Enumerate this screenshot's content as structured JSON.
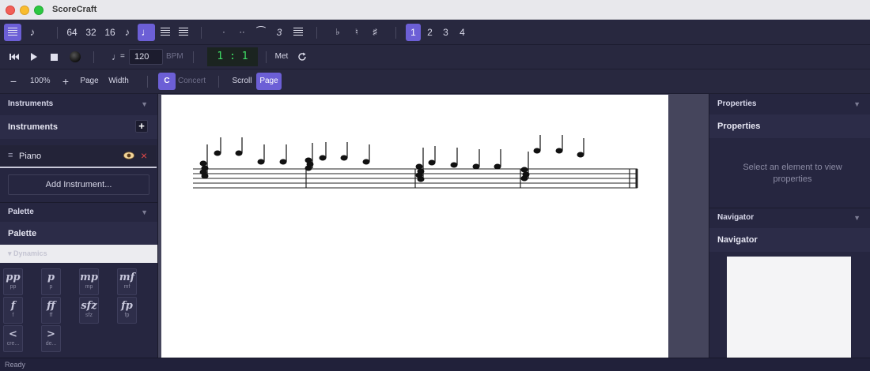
{
  "app": {
    "title": "ScoreCraft"
  },
  "toolbar1": {
    "durations": [
      "64",
      "32",
      "16",
      "♪",
      "♩"
    ],
    "dots": [
      "·",
      "··"
    ],
    "tie": "⁀",
    "tuplet": "3",
    "accidentals": [
      "♭",
      "♮",
      "♯"
    ],
    "voices": [
      "1",
      "2",
      "3",
      "4"
    ]
  },
  "toolbar2": {
    "tempo_note": "♩",
    "tempo_equals": "=",
    "bpm_value": "120",
    "bpm_label": "BPM",
    "position": "1 : 1",
    "metronome_label": "Met"
  },
  "toolbar3": {
    "zoom": "100%",
    "page_fit": "Page",
    "width_fit": "Width",
    "concert_badge": "C",
    "concert_label": "Concert",
    "scroll_label": "Scroll",
    "page_label": "Page"
  },
  "instruments_panel": {
    "header": "Instruments",
    "title": "Instruments",
    "items": [
      {
        "name": "Piano"
      }
    ],
    "add_button": "Add Instrument..."
  },
  "palette_panel": {
    "header": "Palette",
    "title": "Palette",
    "section": "Dynamics",
    "dynamics": [
      {
        "symbol": "pp",
        "label": "pp"
      },
      {
        "symbol": "p",
        "label": "p"
      },
      {
        "symbol": "mp",
        "label": "mp"
      },
      {
        "symbol": "mf",
        "label": "mf"
      },
      {
        "symbol": "f",
        "label": "f"
      },
      {
        "symbol": "ff",
        "label": "ff"
      },
      {
        "symbol": "sfz",
        "label": "sfz"
      },
      {
        "symbol": "fp",
        "label": "fp"
      },
      {
        "symbol": "<",
        "label": "cre..."
      },
      {
        "symbol": ">",
        "label": "de..."
      }
    ]
  },
  "properties_panel": {
    "header": "Properties",
    "title": "Properties",
    "empty_message": "Select an element to view properties"
  },
  "navigator_panel": {
    "header": "Navigator",
    "title": "Navigator"
  },
  "status": {
    "text": "Ready"
  },
  "colors": {
    "accent": "#6c5fd6",
    "panel": "#262640",
    "position_text": "#3fe066"
  }
}
